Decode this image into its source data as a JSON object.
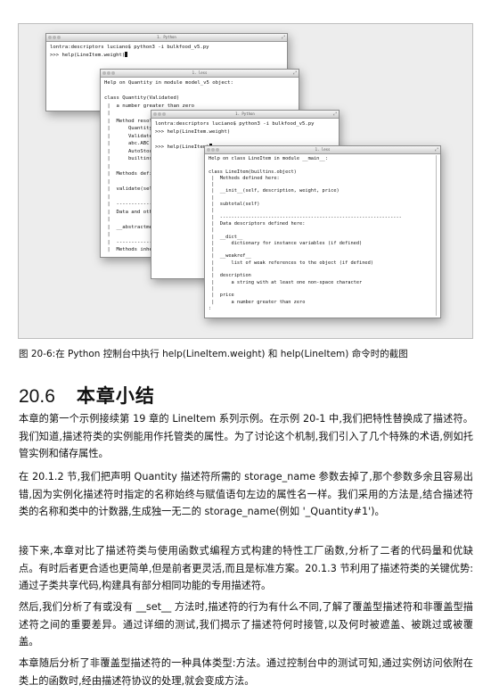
{
  "figure": {
    "win1": {
      "title": "1. Python",
      "lines": [
        "lontra:descriptors luciano$ python3 -i bulkfood_v5.py",
        ">>> help(LineItem.weight)"
      ]
    },
    "win2": {
      "title": "1. less",
      "lines": [
        "Help on Quantity in module model_v5 object:",
        "",
        "class Quantity(Validated)",
        " |  a number greater than zero",
        " |",
        " |  Method resol",
        " |      Quantity",
        " |      Validate",
        " |      abc.ABC",
        " |      AutoStor",
        " |      builtins",
        " |",
        " |  Methods defi",
        " |",
        " |  validate(sel",
        " |",
        " |  ------------",
        " |  Data and othe",
        " |",
        " |  __abstractme",
        " |",
        " |  ------------",
        " |  Methods inhe"
      ]
    },
    "win3": {
      "title": "1. Python",
      "lines": [
        "lontra:descriptors luciano$ python3 -i bulkfood_v5.py",
        ">>> help(LineItem.weight)",
        "",
        ">>> help(LineItem)"
      ]
    },
    "win4": {
      "title": "1. less",
      "lines": [
        "Help on class LineItem in module __main__:",
        "",
        "class LineItem(builtins.object)",
        " |  Methods defined here:",
        " |",
        " |  __init__(self, description, weight, price)",
        " |",
        " |  subtotal(self)",
        " |",
        " |  ----------------------------------------------------------------",
        " |  Data descriptors defined here:",
        " |",
        " |  __dict__",
        " |      dictionary for instance variables (if defined)",
        " |",
        " |  __weakref__",
        " |      list of weak references to the object (if defined)",
        " |",
        " |  description",
        " |      a string with at least one non-space character",
        " |",
        " |  price",
        " |      a number greater than zero",
        ":"
      ]
    }
  },
  "caption": "图 20-6:在 Python 控制台中执行 help(LineItem.weight) 和 help(LineItem) 命令时的截图",
  "section": {
    "number": "20.6",
    "title": "本章小结"
  },
  "paragraphs": [
    "本章的第一个示例接续第 19 章的 LineItem 系列示例。在示例 20-1 中,我们把特性替换成了描述符。我们知道,描述符类的实例能用作托管类的属性。为了讨论这个机制,我们引入了几个特殊的术语,例如托管实例和储存属性。",
    "在 20.1.2 节,我们把声明 Quantity 描述符所需的 storage_name 参数去掉了,那个参数多余且容易出错,因为实例化描述符时指定的名称始终与赋值语句左边的属性名一样。我们采用的方法是,结合描述符类的名称和类中的计数器,生成独一无二的 storage_name(例如 '_Quantity#1')。",
    "接下来,本章对比了描述符类与使用函数式编程方式构建的特性工厂函数,分析了二者的代码量和优缺点。有时后者更合适也更简单,但是前者更灵活,而且是标准方案。20.1.3 节利用了描述符类的关键优势:通过子类共享代码,构建具有部分相同功能的专用描述符。",
    "然后,我们分析了有或没有 __set__ 方法时,描述符的行为有什么不同,了解了覆盖型描述符和非覆盖型描述符之间的重要差异。通过详细的测试,我们揭示了描述符何时接管,以及何时被遮盖、被跳过或被覆盖。",
    "本章随后分析了非覆盖型描述符的一种具体类型:方法。通过控制台中的测试可知,通过实例访问依附在类上的函数时,经由描述符协议的处理,就会变成方法。"
  ]
}
